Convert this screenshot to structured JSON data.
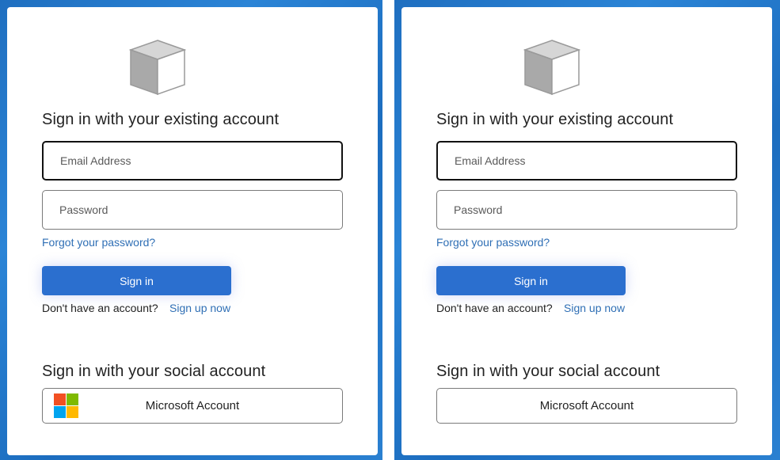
{
  "panels": [
    {
      "logo_icon": "cube-icon",
      "existing_heading": "Sign in with your existing account",
      "email": {
        "placeholder": "Email Address",
        "value": ""
      },
      "password": {
        "placeholder": "Password",
        "value": ""
      },
      "forgot_link": "Forgot your password?",
      "signin_label": "Sign in",
      "no_account_text": "Don't have an account?",
      "signup_link": "Sign up now",
      "social_heading": "Sign in with your social account",
      "social_button": {
        "label": "Microsoft Account",
        "icon": "microsoft-logo-icon"
      }
    },
    {
      "logo_icon": "cube-icon",
      "existing_heading": "Sign in with your existing account",
      "email": {
        "placeholder": "Email Address",
        "value": ""
      },
      "password": {
        "placeholder": "Password",
        "value": ""
      },
      "forgot_link": "Forgot your password?",
      "signin_label": "Sign in",
      "no_account_text": "Don't have an account?",
      "signup_link": "Sign up now",
      "social_heading": "Sign in with your social account",
      "social_button": {
        "label": "Microsoft Account",
        "icon": ""
      }
    }
  ],
  "colors": {
    "background_blue": "#1f6fc0",
    "primary_button": "#2b6fcf",
    "link": "#2f6fb5",
    "ms_red": "#f25022",
    "ms_green": "#7fba00",
    "ms_blue": "#00a4ef",
    "ms_yellow": "#ffb900"
  }
}
